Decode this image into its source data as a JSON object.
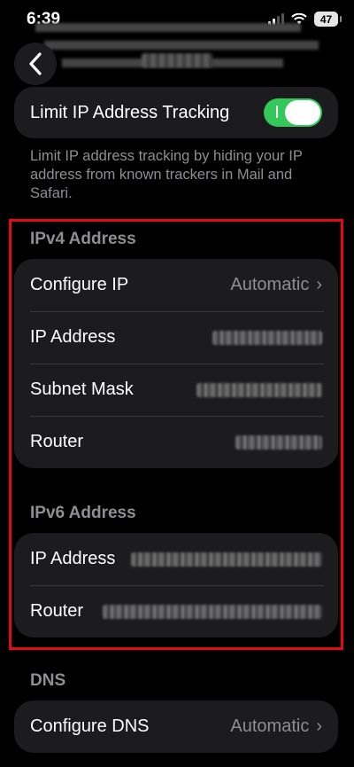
{
  "status_bar": {
    "time": "6:39",
    "battery": "47"
  },
  "nav": {
    "back_icon": "chevron-left-icon"
  },
  "limit_ip": {
    "label": "Limit IP Address Tracking",
    "enabled": true,
    "footnote": "Limit IP address tracking by hiding your IP address from known trackers in Mail and Safari."
  },
  "ipv4": {
    "header": "IPv4 Address",
    "configure_label": "Configure IP",
    "configure_value": "Automatic",
    "ip_label": "IP Address",
    "subnet_label": "Subnet Mask",
    "router_label": "Router"
  },
  "ipv6": {
    "header": "IPv6 Address",
    "ip_label": "IP Address",
    "router_label": "Router"
  },
  "dns": {
    "header": "DNS",
    "configure_label": "Configure DNS",
    "configure_value": "Automatic"
  },
  "colors": {
    "accent_green": "#34c759",
    "highlight_red": "#e50914"
  }
}
